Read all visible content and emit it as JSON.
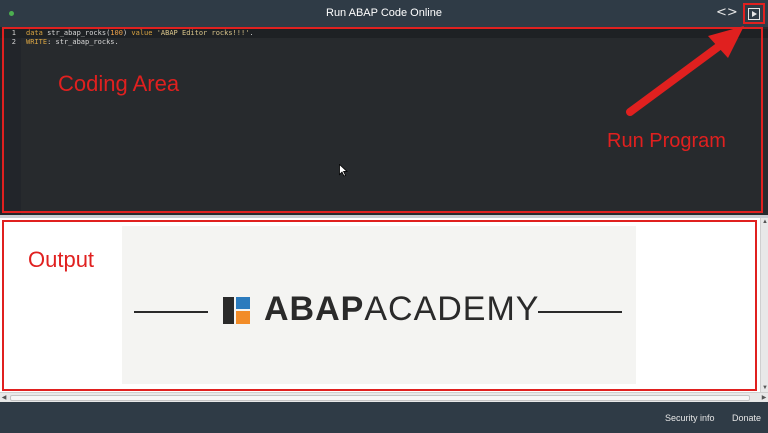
{
  "header": {
    "title": "Run ABAP Code Online",
    "code_icon": "code-brackets-icon",
    "run_icon": "play-icon"
  },
  "editor": {
    "lines": [
      {
        "num": "1",
        "tokens": [
          {
            "t": "data",
            "c": "kw"
          },
          {
            "t": " str_abap_rocks(",
            "c": ""
          },
          {
            "t": "100",
            "c": "num"
          },
          {
            "t": ") ",
            "c": ""
          },
          {
            "t": "value",
            "c": "kw"
          },
          {
            "t": " ",
            "c": ""
          },
          {
            "t": "'ABAP Editor rocks!!!'",
            "c": "str"
          },
          {
            "t": ".",
            "c": ""
          }
        ]
      },
      {
        "num": "2",
        "tokens": [
          {
            "t": "WRITE",
            "c": "kw"
          },
          {
            "t": ": str_abap_rocks.",
            "c": ""
          }
        ]
      }
    ]
  },
  "annotations": {
    "coding_area": "Coding Area",
    "run_program": "Run Program",
    "output": "Output"
  },
  "output": {
    "logo_text_bold": "ABAP",
    "logo_text_light": "ACADEMY"
  },
  "footer": {
    "security_label": "Security info",
    "donate_label": "Donate"
  },
  "colors": {
    "header_bg": "#2f3b46",
    "editor_bg": "#272a2d",
    "annotation": "#e0201f",
    "logo_dark": "#2a2a2a",
    "logo_blue": "#2b7bbd",
    "logo_orange": "#f28c28"
  }
}
